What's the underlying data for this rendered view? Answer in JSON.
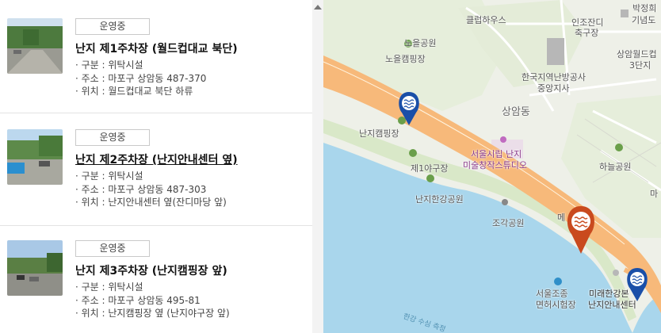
{
  "listings": [
    {
      "status": "운영중",
      "title": "난지 제1주차장 (월드컵대교 북단)",
      "type": "· 구분 : 위탁시설",
      "address": "· 주소 : 마포구 상암동 487-370",
      "location": "· 위치 : 월드컵대교 북단 하류"
    },
    {
      "status": "운영중",
      "title": "난지 제2주차장 (난지안내센터 옆)",
      "type": "· 구분 : 위탁시설",
      "address": "· 주소 : 마포구 상암동 487-303",
      "location": "· 위치 : 난지안내센터 옆(잔디마당 앞)"
    },
    {
      "status": "운영중",
      "title": "난지 제3주차장 (난지캠핑장 앞)",
      "type": "· 구분 : 위탁시설",
      "address": "· 주소 : 마포구 상암동 495-81",
      "location": "· 위치 : 난지캠핑장 옆 (난지야구장 앞)"
    }
  ],
  "map": {
    "labels": {
      "clubhouse": "클럽하우스",
      "noeul_park": "노을공원",
      "noeul_camping": "노을캠핑장",
      "ingonjandi": "인조잔디",
      "ingonjandi2": "축구장",
      "park_museum": "박정희",
      "park_museum2": "기념도",
      "kdhc": "한국지역난방공사",
      "kdhc2": "중앙지사",
      "sangam_arena": "상암월드컵",
      "sangam_arena2": "3단지",
      "sangam_dong": "상암동",
      "nanji_camping": "난지캠핑장",
      "art_studio": "서울시립 난지",
      "art_studio2": "미술창작스튜디오",
      "baseball": "제1야구장",
      "haneul_park": "하늘공원",
      "nanji_hangang": "난지한강공원",
      "sculpture_park": "조각공원",
      "ma": "마",
      "license": "서울조종",
      "license2": "면허시험장",
      "future_hq": "미래한강본",
      "future_hq2": "난지안내센터",
      "water_label": "한강 수심 측정",
      "me": "메"
    },
    "colors": {
      "marker_blue": "#1a4fa8",
      "marker_orange": "#c94a1e",
      "road": "#f5b070",
      "water": "#a9d6ec"
    }
  }
}
